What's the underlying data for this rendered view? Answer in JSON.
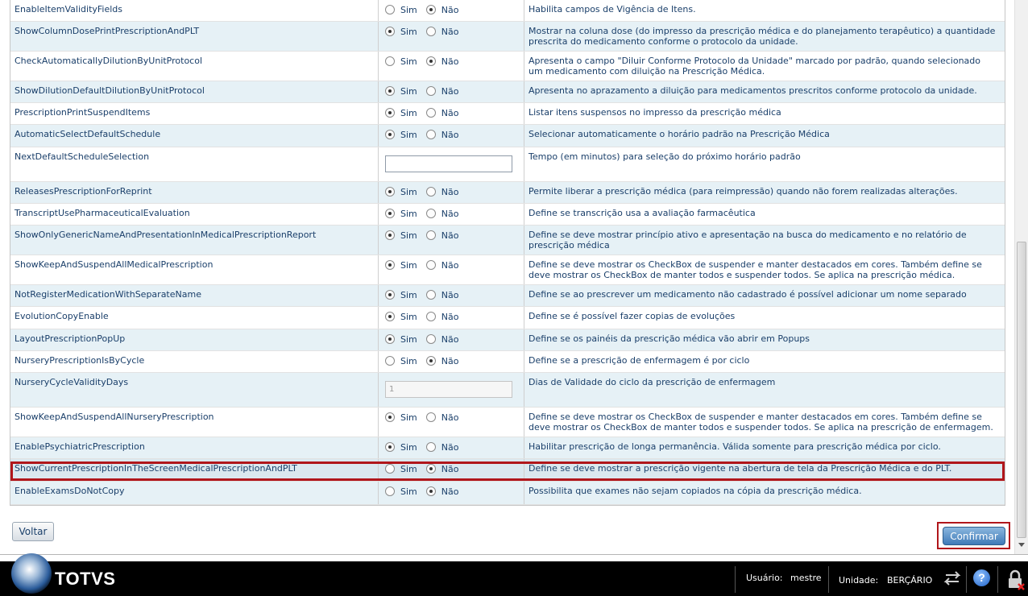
{
  "settings": [
    {
      "name": "EnableItemValidityFields",
      "type": "radio",
      "value": "Não",
      "description": "Habilita campos de Vigência de Itens."
    },
    {
      "name": "ShowColumnDosePrintPrescriptionAndPLT",
      "type": "radio",
      "value": "Sim",
      "description": "Mostrar na coluna dose (do impresso da prescrição médica e do planejamento terapêutico) a quantidade prescrita do medicamento conforme o protocolo da unidade."
    },
    {
      "name": "CheckAutomaticallyDilutionByUnitProtocol",
      "type": "radio",
      "value": "Não",
      "description": "Apresenta o campo \"Diluir Conforme Protocolo da Unidade\" marcado por padrão, quando selecionado um medicamento com diluição na Prescrição Médica."
    },
    {
      "name": "ShowDilutionDefaultDilutionByUnitProtocol",
      "type": "radio",
      "value": "Sim",
      "description": "Apresenta no aprazamento a diluição para medicamentos prescritos conforme protocolo da unidade."
    },
    {
      "name": "PrescriptionPrintSuspendItems",
      "type": "radio",
      "value": "Sim",
      "description": "Listar itens suspensos no impresso da prescrição médica"
    },
    {
      "name": "AutomaticSelectDefaultSchedule",
      "type": "radio",
      "value": "Sim",
      "description": "Selecionar automaticamente o horário padrão na Prescrição Médica"
    },
    {
      "name": "NextDefaultScheduleSelection",
      "type": "text",
      "value": "",
      "description": "Tempo (em minutos) para seleção do próximo horário padrão"
    },
    {
      "name": "ReleasesPrescriptionForReprint",
      "type": "radio",
      "value": "Sim",
      "description": "Permite liberar a prescrição médica (para reimpressão) quando não forem realizadas alterações."
    },
    {
      "name": "TranscriptUsePharmaceuticalEvaluation",
      "type": "radio",
      "value": "Sim",
      "description": "Define se transcrição usa a avaliação farmacêutica"
    },
    {
      "name": "ShowOnlyGenericNameAndPresentationInMedicalPrescriptionReport",
      "type": "radio",
      "value": "Sim",
      "description": "Define se deve mostrar princípio ativo e apresentação na busca do medicamento e no relatório de prescrição médica"
    },
    {
      "name": "ShowKeepAndSuspendAllMedicalPrescription",
      "type": "radio",
      "value": "Sim",
      "description": "Define se deve mostrar os CheckBox de suspender e manter destacados em cores. Também define se deve mostrar os CheckBox de manter todos e suspender todos. Se aplica na prescrição médica."
    },
    {
      "name": "NotRegisterMedicationWithSeparateName",
      "type": "radio",
      "value": "Sim",
      "description": "Define se ao prescrever um medicamento não cadastrado é possível adicionar um nome separado"
    },
    {
      "name": "EvolutionCopyEnable",
      "type": "radio",
      "value": "Sim",
      "description": "Define se é possível fazer copias de evoluções"
    },
    {
      "name": "LayoutPrescriptionPopUp",
      "type": "radio",
      "value": "Sim",
      "description": "Define se os painéis da prescrição médica vão abrir em Popups"
    },
    {
      "name": "NurseryPrescriptionIsByCycle",
      "type": "radio",
      "value": "Não",
      "description": "Define se a prescrição de enfermagem é por ciclo"
    },
    {
      "name": "NurseryCycleValidityDays",
      "type": "text-disabled",
      "value": "1",
      "description": "Dias de Validade do ciclo da prescrição de enfermagem"
    },
    {
      "name": "ShowKeepAndSuspendAllNurseryPrescription",
      "type": "radio",
      "value": "Sim",
      "description": "Define se deve mostrar os CheckBox de suspender e manter destacados em cores. Também define se deve mostrar os CheckBox de manter todos e suspender todos. Se aplica na prescrição de enfermagem."
    },
    {
      "name": "EnablePsychiatricPrescription",
      "type": "radio",
      "value": "Sim",
      "description": "Habilitar prescrição de longa permanência. Válida somente para prescrição médica por ciclo."
    },
    {
      "name": "ShowCurrentPrescriptionInTheScreenMedicalPrescriptionAndPLT",
      "type": "radio",
      "value": "Não",
      "description": "Define se deve mostrar a prescrição vigente na abertura de tela da Prescrição Médica e do PLT."
    },
    {
      "name": "EnableExamsDoNotCopy",
      "type": "radio",
      "value": "Não",
      "description": "Possibilita que exames não sejam copiados na cópia da prescrição médica."
    }
  ],
  "options": {
    "sim": "Sim",
    "nao": "Não"
  },
  "buttons": {
    "back": "Voltar",
    "confirm": "Confirmar"
  },
  "taskbar": {
    "brand": "TOTVS",
    "user_label": "Usuário:",
    "user_value": "mestre",
    "unit_label": "Unidade:",
    "unit_value": "BERÇÁRIO"
  },
  "colors": {
    "highlight": "#b0161b",
    "alt_row": "#e6f1f6",
    "text": "#1a3f6a"
  }
}
